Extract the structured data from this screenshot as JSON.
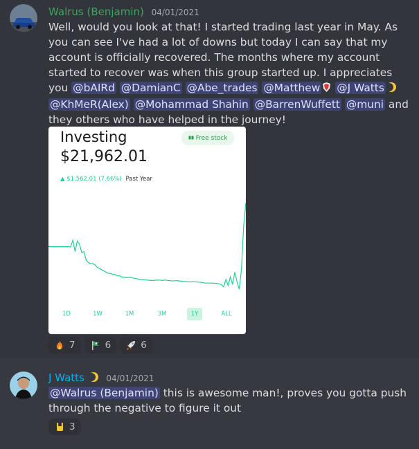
{
  "messages": [
    {
      "author": "Walrus (Benjamin)",
      "author_color": "#3ba55c",
      "timestamp": "04/01/2021",
      "content_parts": [
        {
          "t": "Well, would you look at that! I started trading last year in May. As you can see I've had a lot of downs but today I can say that my account is officially recovered. The months where my account started to recover was when this group started up. I appreciates you "
        },
        {
          "m": "@bAIRd"
        },
        {
          "t": " "
        },
        {
          "m": "@DamianC"
        },
        {
          "t": " "
        },
        {
          "m": "@Abe_trades"
        },
        {
          "t": " "
        },
        {
          "m": "@Matthew"
        },
        {
          "e": "shield-emoji"
        },
        {
          "t": " "
        },
        {
          "m": "@J Watts"
        },
        {
          "e": "moon-emoji"
        },
        {
          "t": " "
        },
        {
          "m": "@KhMeR(Alex)"
        },
        {
          "t": " "
        },
        {
          "m": "@Mohammad Shahin"
        },
        {
          "t": " "
        },
        {
          "m": "@BarrenWuffett"
        },
        {
          "t": " "
        },
        {
          "m": "@muni"
        },
        {
          "t": " and they others who have helped in the journey!"
        }
      ],
      "attachment": {
        "title": "Investing",
        "value": "$21,962.01",
        "badge": "Free stock",
        "change": "▲ $1,562.01 (7.66%)",
        "change_period": "Past Year",
        "accent": "#21ce99",
        "range_tabs": [
          "1D",
          "1W",
          "1M",
          "3M",
          "1Y",
          "ALL"
        ],
        "active_range": "1Y",
        "chart_data": {
          "type": "line",
          "period": "1Y",
          "start_value": 20400,
          "end_value": 21962.01,
          "points": [
            20150,
            20150,
            20150,
            20150,
            20150,
            20150,
            20150,
            20150,
            20150,
            20150,
            20140,
            20420,
            19950,
            20380,
            20250,
            19900,
            19950,
            19600,
            19500,
            19450,
            19450,
            19400,
            19300,
            19250,
            19200,
            19150,
            19100,
            19050,
            19050,
            19000,
            19000,
            18950,
            18950,
            18900,
            18900,
            18870,
            18880,
            18900,
            18860,
            18850,
            18830,
            18800,
            18800,
            18790,
            18780,
            18770,
            18760,
            18760,
            18770,
            18770,
            18780,
            18760,
            18770,
            18770,
            18760,
            18750,
            18740,
            18750,
            18750,
            18740,
            18730,
            18720,
            18710,
            18700,
            18700,
            18710,
            18700,
            18700,
            18690,
            18680,
            18660,
            18650,
            18650,
            18650,
            18650,
            18640,
            18640,
            18620,
            18580,
            18500,
            18800,
            18550,
            18900,
            18600,
            19100,
            18700,
            18400,
            19200,
            21000,
            21960
          ]
        }
      },
      "reactions": [
        {
          "icon": "fire-icon",
          "count": "7"
        },
        {
          "icon": "flag-icon",
          "count": "6"
        },
        {
          "icon": "rocket-icon",
          "count": "6"
        }
      ]
    },
    {
      "author": "J Watts",
      "author_color": "#00b0f4",
      "timestamp": "04/01/2021",
      "content_parts": [
        {
          "m": "@Walrus (Benjamin)"
        },
        {
          "t": " this is awesome man!, proves you gotta push through the negative to figure it out"
        }
      ],
      "reactions": [
        {
          "icon": "rock-on-icon",
          "count": "3"
        }
      ]
    }
  ]
}
